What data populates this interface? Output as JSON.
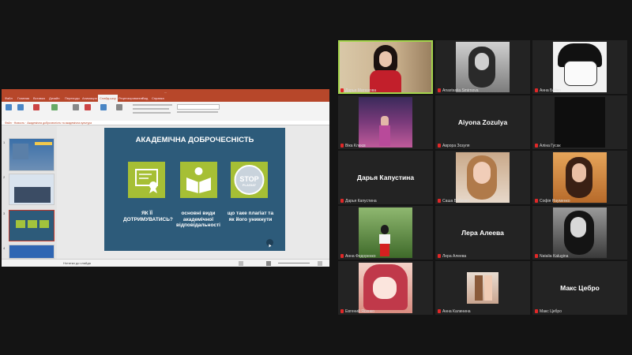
{
  "presentation": {
    "window_title": "...",
    "tabs": [
      "Файл",
      "Главная",
      "Вставка",
      "Дизайн",
      "Переходы",
      "Анимация",
      "Слайд-шоу",
      "Рецензирование",
      "Вид",
      "Справка"
    ],
    "outline_path": "Файл · Новость · Академічна доброчесність та академічна культура",
    "slide_title": "АКАДЕМІЧНА ДОБРОЧЕСНІСТЬ",
    "stop_text": "STOP",
    "stop_subtext": "PLAGIAT",
    "captions": [
      "ЯК ЇЇ ДОТРИМУВАТИСЬ?",
      "основні види академічної відповідальності",
      "що таке плагіат та як його уникнути"
    ],
    "status_text": "Нотатки до слайда"
  },
  "participants": [
    {
      "name": "Дарья Матюхова"
    },
    {
      "name": "Anastasiia Smirnova"
    },
    {
      "name": "Анна Бойко"
    },
    {
      "name": "Віка Клюєв"
    },
    {
      "name": "Аврора Зозуля",
      "display": "Aiyona Zozulya"
    },
    {
      "name": "Аліна Гусак"
    },
    {
      "name": "Дарья Капустина",
      "display": "Дарья Капустина"
    },
    {
      "name": "Саша Бабенко"
    },
    {
      "name": "Софія Науменко"
    },
    {
      "name": "Анна Федоренко"
    },
    {
      "name": "Лера Алеева",
      "display": "Лера Алеева"
    },
    {
      "name": "Natalia Kalugina"
    },
    {
      "name": "Евгений Ясенко"
    },
    {
      "name": "Анна Калинина"
    },
    {
      "name": "Макс Цебро",
      "display": "Макс Цебро"
    }
  ],
  "colors": {
    "active_speaker": "#a3d44b",
    "ppt_brand": "#b7472a",
    "slide_bg": "#2d5b7a",
    "muted_mic": "#e02828"
  }
}
